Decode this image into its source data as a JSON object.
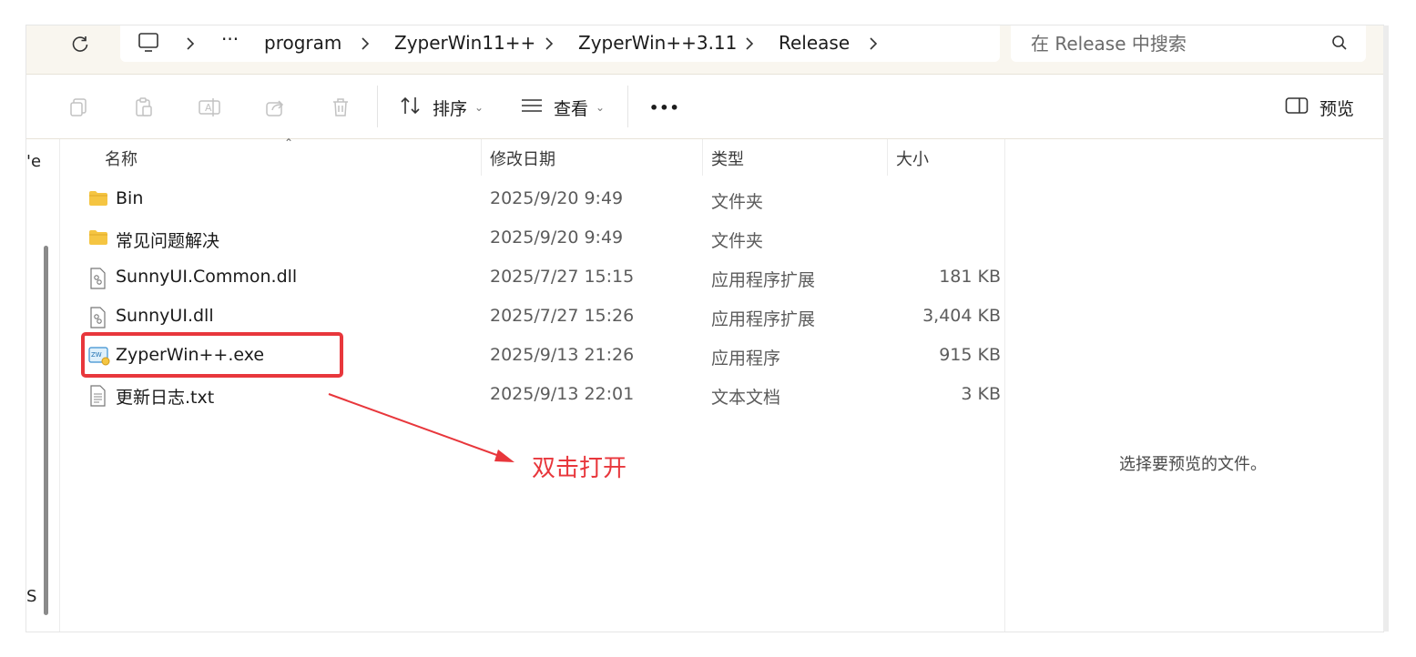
{
  "address": {
    "crumbs": [
      "···",
      "program",
      "ZyperWin11++",
      "ZyperWin++3.11",
      "Release"
    ]
  },
  "search": {
    "placeholder": "在 Release 中搜索"
  },
  "toolbar": {
    "sort_label": "排序",
    "view_label": "查看",
    "more_label": "•••",
    "preview_label": "预览"
  },
  "nav_fragments": [
    "'e",
    "S"
  ],
  "columns": {
    "name": "名称",
    "date": "修改日期",
    "type": "类型",
    "size": "大小"
  },
  "files": [
    {
      "name": "Bin",
      "date": "2025/9/20 9:49",
      "type": "文件夹",
      "size": "",
      "icon": "folder-icon"
    },
    {
      "name": "常见问题解决",
      "date": "2025/9/20 9:49",
      "type": "文件夹",
      "size": "",
      "icon": "folder-icon"
    },
    {
      "name": "SunnyUI.Common.dll",
      "date": "2025/7/27 15:15",
      "type": "应用程序扩展",
      "size": "181 KB",
      "icon": "dll-icon"
    },
    {
      "name": "SunnyUI.dll",
      "date": "2025/7/27 15:26",
      "type": "应用程序扩展",
      "size": "3,404 KB",
      "icon": "dll-icon"
    },
    {
      "name": "ZyperWin++.exe",
      "date": "2025/9/13 21:26",
      "type": "应用程序",
      "size": "915 KB",
      "icon": "exe-icon"
    },
    {
      "name": "更新日志.txt",
      "date": "2025/9/13 22:01",
      "type": "文本文档",
      "size": "3 KB",
      "icon": "txt-icon"
    }
  ],
  "annotation": {
    "text": "双击打开",
    "color": "#e8373c"
  },
  "preview": {
    "message": "选择要预览的文件。"
  },
  "colors": {
    "folder": "#f5c542",
    "accent_red": "#e8373c",
    "titlebar_bg": "#f9f6ef"
  }
}
